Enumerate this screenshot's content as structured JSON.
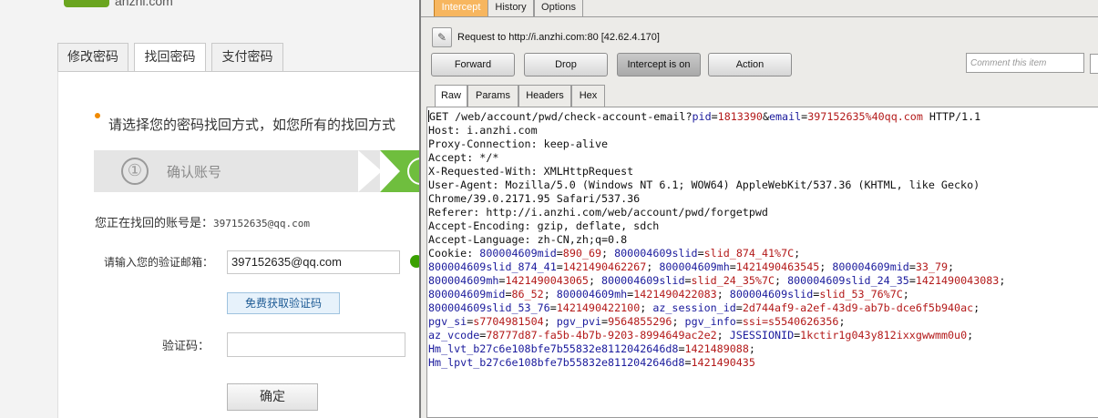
{
  "web": {
    "logo_text": "anzhi.com",
    "tabs": [
      "修改密码",
      "找回密码",
      "支付密码"
    ],
    "active_tab": 1,
    "instruction": "请选择您的密码找回方式，如您所有的找回方式",
    "step1_number": "①",
    "step1_label": "确认账号",
    "account_label": "您正在找回的账号是：",
    "account_value": "397152635@qq.com",
    "email_label": "请输入您的验证邮箱：",
    "email_value": "397152635@qq.com",
    "get_code_button": "免费获取验证码",
    "code_label": "验证码：",
    "confirm_button": "确定"
  },
  "burp": {
    "tabs": [
      "Intercept",
      "History",
      "Options"
    ],
    "active_tab": "Intercept",
    "request_label": "Request to http://i.anzhi.com:80  [42.62.4.170]",
    "buttons": {
      "forward": "Forward",
      "drop": "Drop",
      "intercept": "Intercept is on",
      "action": "Action"
    },
    "comment_placeholder": "Comment this item",
    "view_tabs": [
      "Raw",
      "Params",
      "Headers",
      "Hex"
    ],
    "request_line": {
      "method_path": "GET /web/account/pwd/check-account-email?",
      "p1_name": "pid",
      "p1_value": "1813390",
      "p2_name": "email",
      "p2_value": "397152635%40qq.com",
      "protocol": " HTTP/1.1"
    },
    "headers": [
      "Host: i.anzhi.com",
      "Proxy-Connection: keep-alive",
      "Accept: */*",
      "X-Requested-With: XMLHttpRequest",
      "User-Agent: Mozilla/5.0 (Windows NT 6.1; WOW64) AppleWebKit/537.36 (KHTML, like Gecko)",
      "Chrome/39.0.2171.95 Safari/537.36",
      "Referer: http://i.anzhi.com/web/account/pwd/forgetpwd",
      "Accept-Encoding: gzip, deflate, sdch",
      "Accept-Language: zh-CN,zh;q=0.8"
    ],
    "cookie_label": "Cookie: ",
    "cookies": [
      {
        "name": "800004609mid",
        "value": "890_69"
      },
      {
        "name": "800004609slid",
        "value": "slid_874_41%7C"
      },
      {
        "name": "800004609slid_874_41",
        "value": "1421490462267"
      },
      {
        "name": "800004609mh",
        "value": "1421490463545"
      },
      {
        "name": "800004609mid",
        "value": "33_79"
      },
      {
        "name": "800004609mh",
        "value": "1421490043065"
      },
      {
        "name": "800004609slid",
        "value": "slid_24_35%7C"
      },
      {
        "name": "800004609slid_24_35",
        "value": "1421490043083"
      },
      {
        "name": "800004609mid",
        "value": "86_52"
      },
      {
        "name": "800004609mh",
        "value": "1421490422083"
      },
      {
        "name": "800004609slid",
        "value": "slid_53_76%7C"
      },
      {
        "name": "800004609slid_53_76",
        "value": "1421490422100"
      },
      {
        "name": "az_session_id",
        "value": "2d744af9-a2ef-43d9-ab7b-dce6f5b940ac"
      },
      {
        "name": "pgv_si",
        "value": "s7704981504"
      },
      {
        "name": "pgv_pvi",
        "value": "9564855296"
      },
      {
        "name": "pgv_info",
        "value": "ssi=s5540626356"
      },
      {
        "name": "az_vcode",
        "value": "78777d87-fa5b-4b7b-9203-8994649ac2e2"
      },
      {
        "name": "JSESSIONID",
        "value": "1kctir1g043y812ixxgwwmm0u0"
      },
      {
        "name": "Hm_lvt_b27c6e108bfe7b55832e8112042646d8",
        "value": "1421489088"
      },
      {
        "name": "Hm_lpvt_b27c6e108bfe7b55832e8112042646d8",
        "value": "1421490435"
      }
    ]
  }
}
